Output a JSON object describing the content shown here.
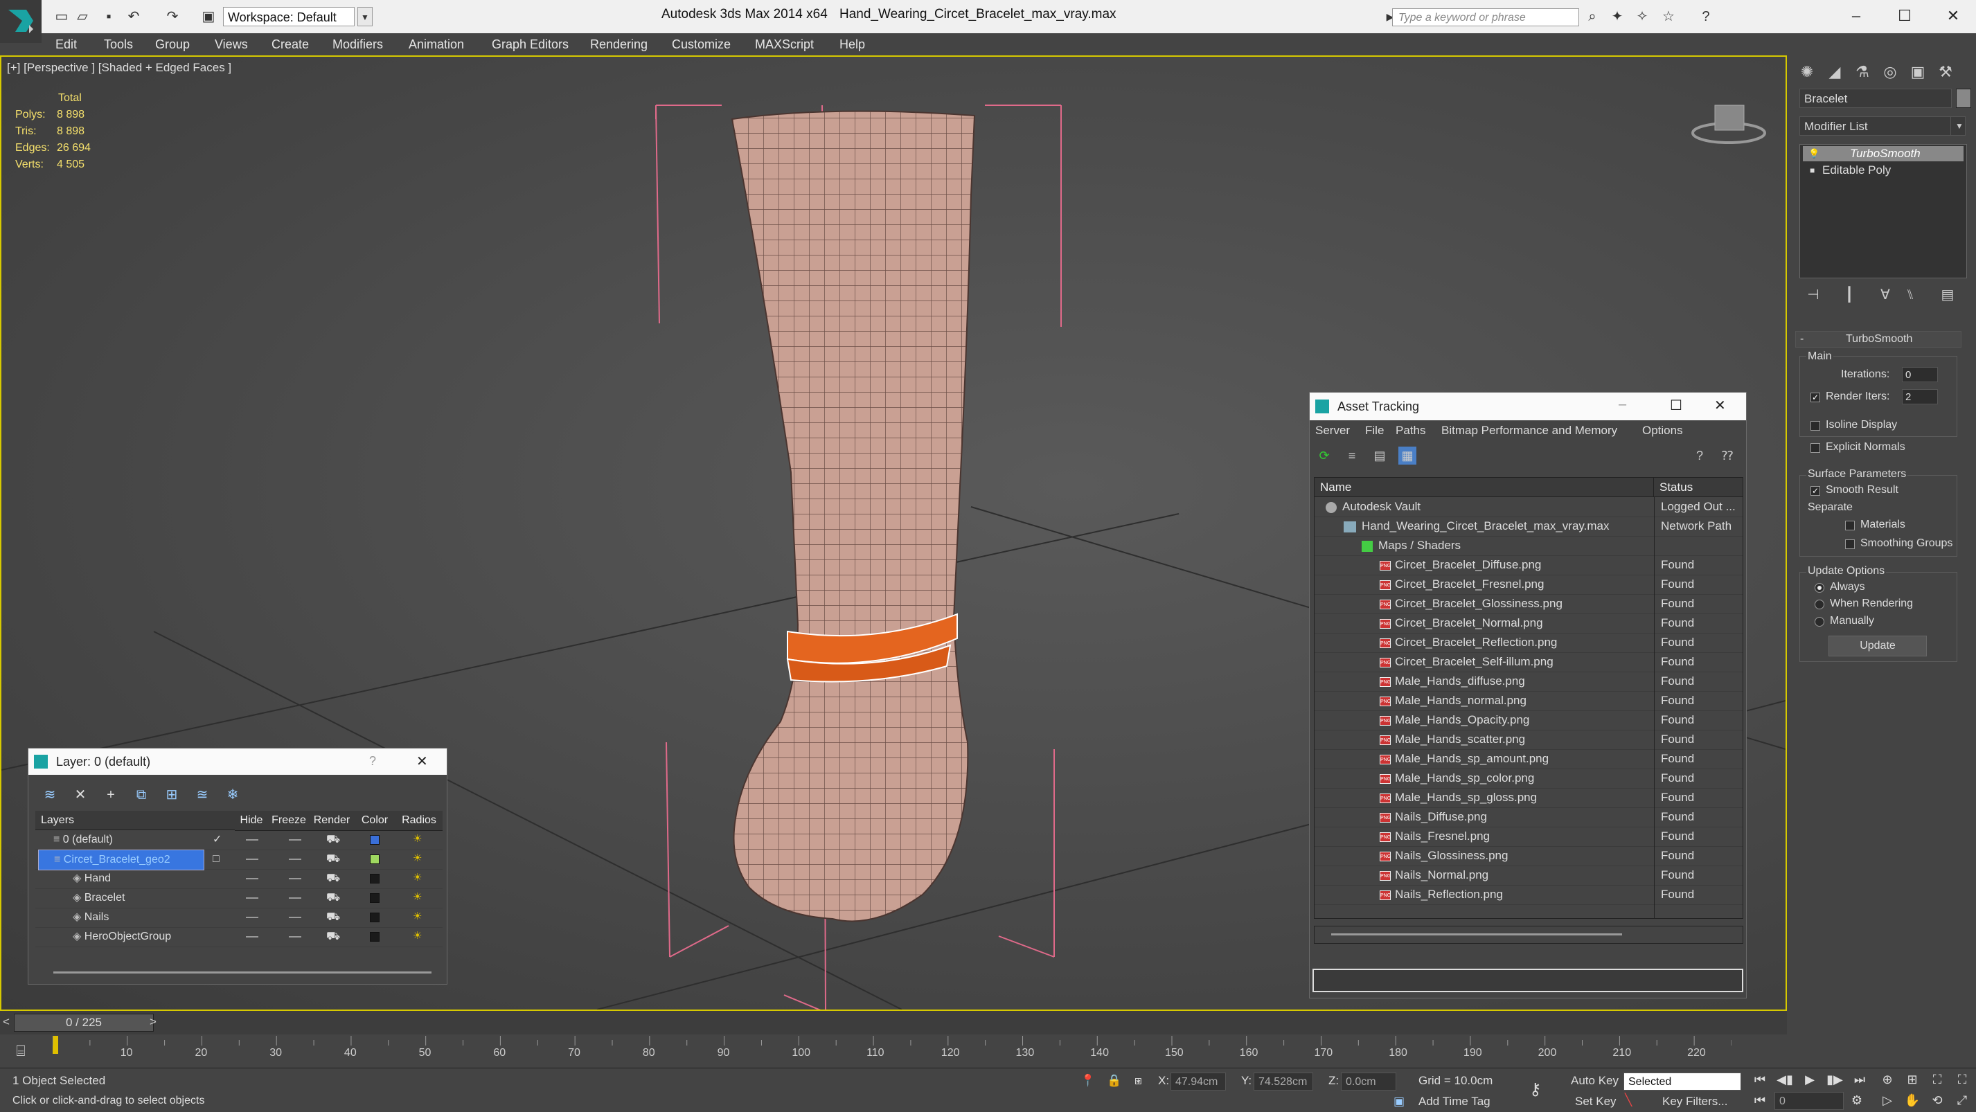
{
  "app": {
    "title": "Autodesk 3ds Max  2014 x64",
    "file": "Hand_Wearing_Circet_Bracelet_max_vray.max",
    "workspace": "Workspace: Default",
    "search_placeholder": "Type a keyword or phrase"
  },
  "menu": [
    "Edit",
    "Tools",
    "Group",
    "Views",
    "Create",
    "Modifiers",
    "Animation",
    "Graph Editors",
    "Rendering",
    "Customize",
    "MAXScript",
    "Help"
  ],
  "viewport": {
    "label": "[+] [Perspective ] [Shaded + Edged Faces ]",
    "stats": {
      "header": "Total",
      "rows": [
        {
          "label": "Polys:",
          "value": "8 898"
        },
        {
          "label": "Tris:",
          "value": "8 898"
        },
        {
          "label": "Edges:",
          "value": "26 694"
        },
        {
          "label": "Verts:",
          "value": "4 505"
        }
      ]
    }
  },
  "command_panel": {
    "object_name": "Bracelet",
    "modifier_list": "Modifier List",
    "stack": [
      "TurboSmooth",
      "Editable Poly"
    ],
    "rollout": {
      "title": "TurboSmooth",
      "main": "Main",
      "iterations_label": "Iterations:",
      "iterations": "0",
      "render_iters_label": "Render Iters:",
      "render_iters": "2",
      "isoline": "Isoline Display",
      "explicit_normals": "Explicit Normals",
      "surface_params": "Surface Parameters",
      "smooth_result": "Smooth Result",
      "separate": "Separate",
      "materials": "Materials",
      "smoothing_groups": "Smoothing Groups",
      "update_options": "Update Options",
      "always": "Always",
      "when_rendering": "When Rendering",
      "manually": "Manually",
      "update": "Update"
    }
  },
  "asset_tracking": {
    "title": "Asset Tracking",
    "menu": [
      "Server",
      "File",
      "Paths",
      "Bitmap Performance and Memory",
      "Options"
    ],
    "col_name": "Name",
    "col_status": "Status",
    "rows": [
      {
        "name": "Autodesk Vault",
        "status": "Logged Out ...",
        "indent": 0,
        "icon": "vault"
      },
      {
        "name": "Hand_Wearing_Circet_Bracelet_max_vray.max",
        "status": "Network Path",
        "indent": 1,
        "icon": "max"
      },
      {
        "name": "Maps / Shaders",
        "status": "",
        "indent": 2,
        "icon": "maps"
      },
      {
        "name": "Circet_Bracelet_Diffuse.png",
        "status": "Found",
        "indent": 3,
        "icon": "png"
      },
      {
        "name": "Circet_Bracelet_Fresnel.png",
        "status": "Found",
        "indent": 3,
        "icon": "png"
      },
      {
        "name": "Circet_Bracelet_Glossiness.png",
        "status": "Found",
        "indent": 3,
        "icon": "png"
      },
      {
        "name": "Circet_Bracelet_Normal.png",
        "status": "Found",
        "indent": 3,
        "icon": "png"
      },
      {
        "name": "Circet_Bracelet_Reflection.png",
        "status": "Found",
        "indent": 3,
        "icon": "png"
      },
      {
        "name": "Circet_Bracelet_Self-illum.png",
        "status": "Found",
        "indent": 3,
        "icon": "png"
      },
      {
        "name": "Male_Hands_diffuse.png",
        "status": "Found",
        "indent": 3,
        "icon": "png"
      },
      {
        "name": "Male_Hands_normal.png",
        "status": "Found",
        "indent": 3,
        "icon": "png"
      },
      {
        "name": "Male_Hands_Opacity.png",
        "status": "Found",
        "indent": 3,
        "icon": "png"
      },
      {
        "name": "Male_Hands_scatter.png",
        "status": "Found",
        "indent": 3,
        "icon": "png"
      },
      {
        "name": "Male_Hands_sp_amount.png",
        "status": "Found",
        "indent": 3,
        "icon": "png"
      },
      {
        "name": "Male_Hands_sp_color.png",
        "status": "Found",
        "indent": 3,
        "icon": "png"
      },
      {
        "name": "Male_Hands_sp_gloss.png",
        "status": "Found",
        "indent": 3,
        "icon": "png"
      },
      {
        "name": "Nails_Diffuse.png",
        "status": "Found",
        "indent": 3,
        "icon": "png"
      },
      {
        "name": "Nails_Fresnel.png",
        "status": "Found",
        "indent": 3,
        "icon": "png"
      },
      {
        "name": "Nails_Glossiness.png",
        "status": "Found",
        "indent": 3,
        "icon": "png"
      },
      {
        "name": "Nails_Normal.png",
        "status": "Found",
        "indent": 3,
        "icon": "png"
      },
      {
        "name": "Nails_Reflection.png",
        "status": "Found",
        "indent": 3,
        "icon": "png"
      }
    ]
  },
  "layers": {
    "title": "Layer: 0 (default)",
    "help": "?",
    "columns": [
      "Layers",
      "Hide",
      "Freeze",
      "Render",
      "Color",
      "Radios"
    ],
    "rows": [
      {
        "name": "0 (default)",
        "indent": 0,
        "color": "#3a6fd8",
        "selected": false,
        "check": "✓"
      },
      {
        "name": "Circet_Bracelet_geo2",
        "indent": 0,
        "color": "#9fd860",
        "selected": true,
        "check": "□"
      },
      {
        "name": "Hand",
        "indent": 1,
        "color": "#1a1a1a",
        "selected": false,
        "check": ""
      },
      {
        "name": "Bracelet",
        "indent": 1,
        "color": "#1a1a1a",
        "selected": false,
        "check": ""
      },
      {
        "name": "Nails",
        "indent": 1,
        "color": "#1a1a1a",
        "selected": false,
        "check": ""
      },
      {
        "name": "HeroObjectGroup",
        "indent": 1,
        "color": "#1a1a1a",
        "selected": false,
        "check": ""
      }
    ]
  },
  "timeline": {
    "frame": "0 / 225",
    "ticks": [
      "10",
      "20",
      "30",
      "40",
      "50",
      "60",
      "70",
      "80",
      "90",
      "100",
      "110",
      "120",
      "130",
      "140",
      "150",
      "160",
      "170",
      "180",
      "190",
      "200",
      "210",
      "220"
    ]
  },
  "status": {
    "selected": "1 Object Selected",
    "hint": "Click or click-and-drag to select objects",
    "x_label": "X:",
    "x": "47.94cm",
    "y_label": "Y:",
    "y": "74.528cm",
    "z_label": "Z:",
    "z": "0.0cm",
    "grid": "Grid = 10.0cm",
    "add_time_tag": "Add Time Tag",
    "auto_key": "Auto Key",
    "set_key": "Set Key",
    "selected_dropdown": "Selected",
    "key_filters": "Key Filters...",
    "frame_value": "0"
  }
}
